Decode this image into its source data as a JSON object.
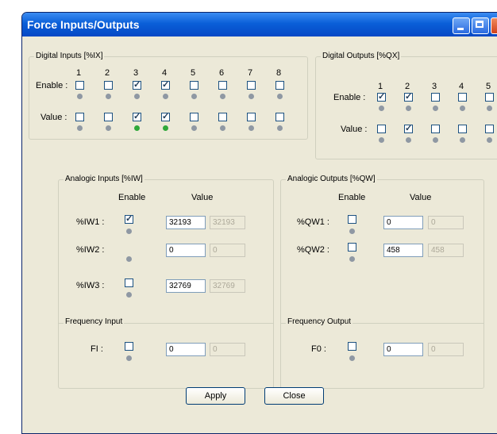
{
  "window": {
    "title": "Force Inputs/Outputs"
  },
  "digital_inputs": {
    "title": "Digital Inputs [%IX]",
    "channels": [
      "1",
      "2",
      "3",
      "4",
      "5",
      "6",
      "7",
      "8"
    ],
    "enable_label": "Enable :",
    "value_label": "Value :",
    "enable": [
      false,
      false,
      true,
      true,
      false,
      false,
      false,
      false
    ],
    "value": [
      false,
      false,
      true,
      true,
      false,
      false,
      false,
      false
    ],
    "led": [
      false,
      false,
      true,
      true,
      false,
      false,
      false,
      false
    ]
  },
  "digital_outputs": {
    "title": "Digital Outputs [%QX]",
    "channels": [
      "1",
      "2",
      "3",
      "4",
      "5"
    ],
    "enable_label": "Enable :",
    "value_label": "Value :",
    "enable": [
      true,
      true,
      false,
      false,
      false
    ],
    "value": [
      false,
      true,
      false,
      false,
      false
    ]
  },
  "analogic_inputs": {
    "title": "Analogic Inputs [%IW]",
    "col_enable": "Enable",
    "col_value": "Value",
    "rows": [
      {
        "label": "%IW1 :",
        "enabled": true,
        "value": "32193",
        "readout": "32193"
      },
      {
        "label": "%IW2 :",
        "enabled": null,
        "value": "0",
        "readout": "0"
      },
      {
        "label": "%IW3 :",
        "enabled": false,
        "value": "32769",
        "readout": "32769"
      }
    ]
  },
  "analogic_outputs": {
    "title": "Analogic Outputs [%QW]",
    "col_enable": "Enable",
    "col_value": "Value",
    "rows": [
      {
        "label": "%QW1 :",
        "enabled": false,
        "value": "0",
        "readout": "0"
      },
      {
        "label": "%QW2 :",
        "enabled": false,
        "value": "458",
        "readout": "458"
      }
    ]
  },
  "frequency_input": {
    "title": "Frequency Input",
    "label": "FI :",
    "enabled": false,
    "value": "0",
    "readout": "0"
  },
  "frequency_output": {
    "title": "Frequency Output",
    "label": "F0 :",
    "enabled": false,
    "value": "0",
    "readout": "0"
  },
  "buttons": {
    "apply": "Apply",
    "close": "Close"
  }
}
